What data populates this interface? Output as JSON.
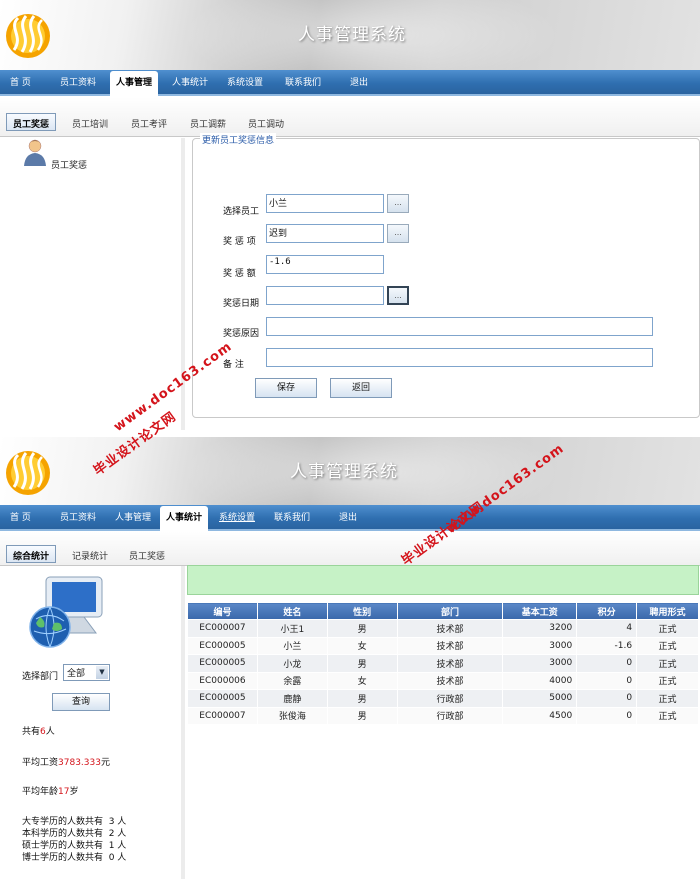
{
  "app": {
    "title": "人事管理系统"
  },
  "panel1": {
    "nav": [
      "首 页",
      "员工资料",
      "人事管理",
      "人事统计",
      "系统设置",
      "联系我们",
      "退出"
    ],
    "nav_active": "人事管理",
    "subtabs": [
      "员工奖惩",
      "员工培训",
      "员工考评",
      "员工调薪",
      "员工调动"
    ],
    "sidebar_item": "员工奖惩",
    "form": {
      "legend": "更新员工奖惩信息",
      "employee_label": "选择员工",
      "employee_value": "小兰",
      "item_label": "奖 惩 项",
      "item_value": "迟到",
      "amount_label": "奖 惩 额",
      "amount_value": "-1.6",
      "date_label": "奖惩日期",
      "date_value": "",
      "reason_label": "奖惩原因",
      "reason_value": "",
      "remark_label": "备  注",
      "remark_value": "",
      "picker": "...",
      "save": "保存",
      "back": "返回"
    }
  },
  "panel2": {
    "nav": [
      "首 页",
      "员工资料",
      "人事管理",
      "人事统计",
      "系统设置",
      "联系我们",
      "退出"
    ],
    "nav_active": "人事统计",
    "subtabs": [
      "综合统计",
      "记录统计",
      "员工奖惩"
    ],
    "dept_label": "选择部门",
    "dept_value": "全部",
    "query": "查询",
    "total_prefix": "共有",
    "total_value": "6",
    "total_suffix": "人",
    "avg_salary_prefix": "平均工资",
    "avg_salary_value": "3783.333",
    "avg_salary_suffix": "元",
    "avg_age_prefix": "平均年龄",
    "avg_age_value": "17",
    "avg_age_suffix": "岁",
    "education": [
      "大专学历的人数共有  3 人",
      "本科学历的人数共有  2 人",
      "硕士学历的人数共有  1 人",
      "博士学历的人数共有  0 人"
    ],
    "table": {
      "headers": [
        "编号",
        "姓名",
        "性别",
        "部门",
        "基本工资",
        "积分",
        "聘用形式"
      ],
      "rows": [
        [
          "EC000007",
          "小王1",
          "男",
          "技术部",
          "3200",
          "4",
          "正式"
        ],
        [
          "EC000005",
          "小兰",
          "女",
          "技术部",
          "3000",
          "-1.6",
          "正式"
        ],
        [
          "EC000005",
          "小龙",
          "男",
          "技术部",
          "3000",
          "0",
          "正式"
        ],
        [
          "EC000006",
          "余露",
          "女",
          "技术部",
          "4000",
          "0",
          "正式"
        ],
        [
          "EC000005",
          "鹿静",
          "男",
          "行政部",
          "5000",
          "0",
          "正式"
        ],
        [
          "EC000007",
          "张俊海",
          "男",
          "行政部",
          "4500",
          "0",
          "正式"
        ]
      ]
    }
  },
  "watermarks": {
    "url": "www.doc163.com",
    "cn": "毕业设计论文网"
  },
  "colors": {
    "nav_blue": "#2f6fb0",
    "accent_red": "#d4141b",
    "header_blue": "#3a68aa"
  }
}
